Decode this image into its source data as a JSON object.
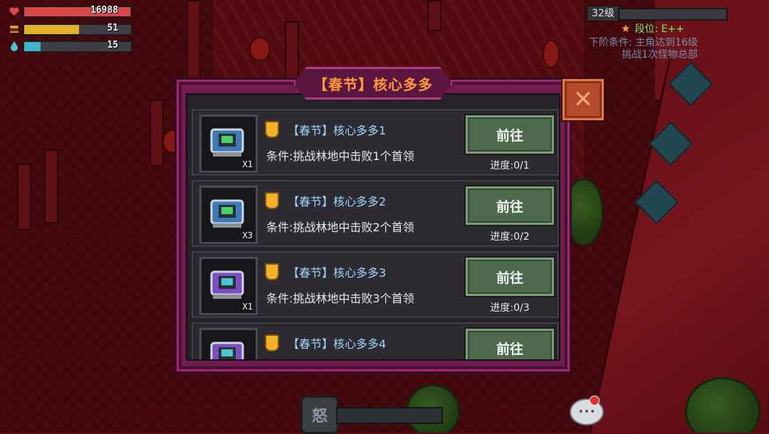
{
  "hud": {
    "hp": {
      "value": "16988",
      "fraction": 0.99,
      "color": "#d84848",
      "icon": "heart-icon"
    },
    "food": {
      "value": "51",
      "fraction": 0.51,
      "color": "#e3b02b",
      "icon": "burger-icon"
    },
    "water": {
      "value": "15",
      "fraction": 0.15,
      "color": "#3fb3c8",
      "icon": "water-drop-icon"
    },
    "level_label": "32级",
    "rank_label": "段位: E++",
    "quest_hint_line1": "下阶条件: 主角达到16级",
    "quest_hint_line2": "挑战1次怪物总部"
  },
  "dialog": {
    "title": "【春节】核心多多",
    "close_label": "✕",
    "items": [
      {
        "name": "【春节】核心多多1",
        "condition": "条件:挑战林地中击败1个首领",
        "button": "前往",
        "progress": "进度:0/1",
        "qty": "X1",
        "chest_color": "blue"
      },
      {
        "name": "【春节】核心多多2",
        "condition": "条件:挑战林地中击败2个首领",
        "button": "前往",
        "progress": "进度:0/2",
        "qty": "X3",
        "chest_color": "blue"
      },
      {
        "name": "【春节】核心多多3",
        "condition": "条件:挑战林地中击败3个首领",
        "button": "前往",
        "progress": "进度:0/3",
        "qty": "X1",
        "chest_color": "purple"
      },
      {
        "name": "【春节】核心多多4",
        "condition": "",
        "button": "前往",
        "progress": "",
        "qty": "",
        "chest_color": "purple"
      }
    ]
  },
  "bottom": {
    "skill_glyph": "怒"
  },
  "colors": {
    "accent_orange": "#ff9a3c",
    "name_blue": "#9ed9ff",
    "button_green": "#4d6a4d",
    "dialog_magenta": "#701c4f"
  }
}
